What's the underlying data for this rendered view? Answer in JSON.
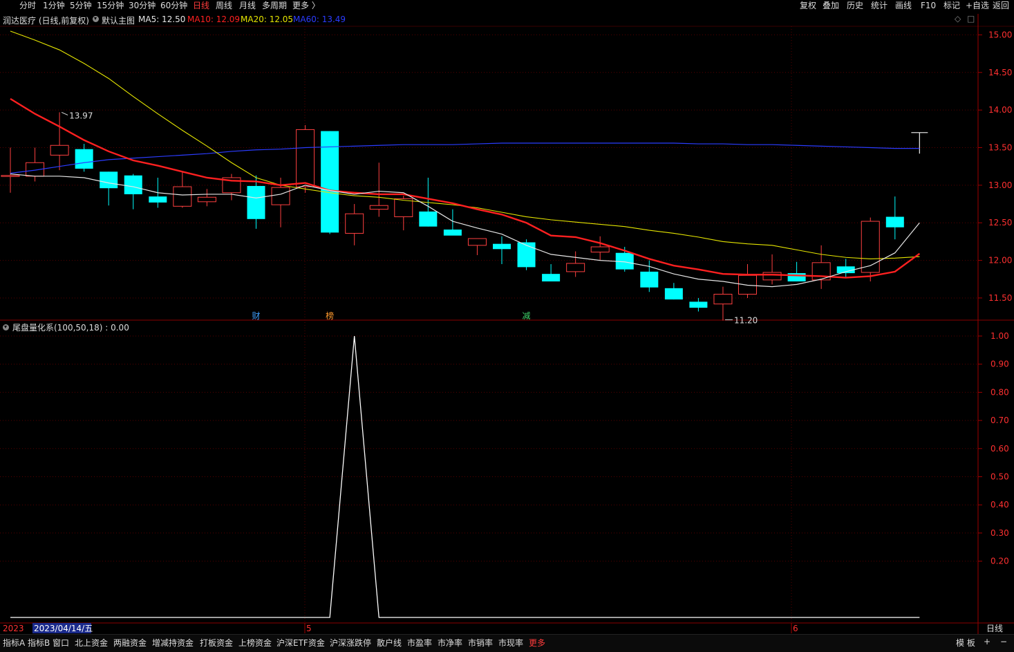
{
  "toolbar": {
    "periods": [
      "分时",
      "1分钟",
      "5分钟",
      "15分钟",
      "30分钟",
      "60分钟",
      "日线",
      "周线",
      "月线",
      "多周期",
      "更多 〉"
    ],
    "active_period": "日线",
    "right_tools": [
      "复权",
      "叠加",
      "历史",
      "统计",
      "画线",
      "F10",
      "标记",
      "+自选",
      "返回"
    ]
  },
  "main_panel": {
    "stock_title": "润达医疗 (日线,前复权)",
    "template_label": "默认主图",
    "ma": [
      {
        "label": "MA5: 12.50",
        "color": "#e6e6e6"
      },
      {
        "label": "MA10: 12.09",
        "color": "#ff2020"
      },
      {
        "label": "MA20: 12.05",
        "color": "#e6e600"
      },
      {
        "label": "MA60: 13.49",
        "color": "#2b3cff"
      }
    ],
    "high_marker": "13.97",
    "low_marker": "11.20",
    "event_tags": [
      {
        "text": "财",
        "color": "#3fa0ff"
      },
      {
        "text": "榜",
        "color": "#ff9a2e"
      },
      {
        "text": "减",
        "color": "#3fd36a"
      }
    ],
    "price_axis": [
      "15.00",
      "14.50",
      "14.00",
      "13.50",
      "13.00",
      "12.50",
      "12.00",
      "11.50"
    ],
    "ylim": [
      11.15,
      15.05
    ]
  },
  "indicator_panel": {
    "title": "尾盘量化系(100,50,18) : 0.00",
    "axis": [
      "1.00",
      "0.90",
      "0.80",
      "0.70",
      "0.60",
      "0.50",
      "0.40",
      "0.30",
      "0.20"
    ],
    "ylim": [
      0,
      1.0
    ]
  },
  "date_axis": {
    "start_label": "2023",
    "cursor_date": "2023/04/14/五",
    "month_labels": [
      "5",
      "6"
    ],
    "period_label": "日线"
  },
  "chart_data": {
    "type": "candlestick",
    "candles": [
      {
        "o": 13.13,
        "h": 13.5,
        "l": 12.9,
        "c": 13.13
      },
      {
        "o": 13.12,
        "h": 13.5,
        "l": 13.05,
        "c": 13.3
      },
      {
        "o": 13.4,
        "h": 13.97,
        "l": 13.2,
        "c": 13.53
      },
      {
        "o": 13.48,
        "h": 13.55,
        "l": 13.18,
        "c": 13.22
      },
      {
        "o": 13.18,
        "h": 13.18,
        "l": 12.73,
        "c": 12.96
      },
      {
        "o": 13.13,
        "h": 13.15,
        "l": 12.68,
        "c": 12.88
      },
      {
        "o": 12.85,
        "h": 13.1,
        "l": 12.7,
        "c": 12.77
      },
      {
        "o": 12.72,
        "h": 13.18,
        "l": 12.7,
        "c": 12.98
      },
      {
        "o": 12.78,
        "h": 12.95,
        "l": 12.72,
        "c": 12.84
      },
      {
        "o": 12.9,
        "h": 13.15,
        "l": 12.8,
        "c": 13.1
      },
      {
        "o": 12.99,
        "h": 13.13,
        "l": 12.42,
        "c": 12.55
      },
      {
        "o": 12.74,
        "h": 13.1,
        "l": 12.44,
        "c": 12.97
      },
      {
        "o": 12.98,
        "h": 13.8,
        "l": 12.9,
        "c": 13.74
      },
      {
        "o": 13.72,
        "h": 13.72,
        "l": 12.35,
        "c": 12.37
      },
      {
        "o": 12.36,
        "h": 12.75,
        "l": 12.2,
        "c": 12.62
      },
      {
        "o": 12.68,
        "h": 13.3,
        "l": 12.58,
        "c": 12.73
      },
      {
        "o": 12.58,
        "h": 12.86,
        "l": 12.4,
        "c": 12.82
      },
      {
        "o": 12.65,
        "h": 13.1,
        "l": 12.45,
        "c": 12.45
      },
      {
        "o": 12.41,
        "h": 12.68,
        "l": 12.35,
        "c": 12.33
      },
      {
        "o": 12.2,
        "h": 12.22,
        "l": 12.07,
        "c": 12.29
      },
      {
        "o": 12.22,
        "h": 12.32,
        "l": 11.95,
        "c": 12.15
      },
      {
        "o": 12.24,
        "h": 12.28,
        "l": 11.87,
        "c": 11.91
      },
      {
        "o": 11.82,
        "h": 11.95,
        "l": 11.75,
        "c": 11.72
      },
      {
        "o": 11.85,
        "h": 12.12,
        "l": 11.78,
        "c": 11.96
      },
      {
        "o": 12.11,
        "h": 12.32,
        "l": 12.0,
        "c": 12.18
      },
      {
        "o": 12.1,
        "h": 12.18,
        "l": 11.85,
        "c": 11.88
      },
      {
        "o": 11.85,
        "h": 12.0,
        "l": 11.58,
        "c": 11.64
      },
      {
        "o": 11.63,
        "h": 11.7,
        "l": 11.48,
        "c": 11.48
      },
      {
        "o": 11.45,
        "h": 11.5,
        "l": 11.32,
        "c": 11.37
      },
      {
        "o": 11.42,
        "h": 11.65,
        "l": 11.2,
        "c": 11.55
      },
      {
        "o": 11.55,
        "h": 11.95,
        "l": 11.5,
        "c": 11.8
      },
      {
        "o": 11.74,
        "h": 12.08,
        "l": 11.68,
        "c": 11.84
      },
      {
        "o": 11.83,
        "h": 11.98,
        "l": 11.72,
        "c": 11.72
      },
      {
        "o": 11.74,
        "h": 12.2,
        "l": 11.62,
        "c": 11.97
      },
      {
        "o": 11.92,
        "h": 12.02,
        "l": 11.77,
        "c": 11.83
      },
      {
        "o": 11.84,
        "h": 12.57,
        "l": 11.72,
        "c": 12.52
      },
      {
        "o": 12.58,
        "h": 12.85,
        "l": 12.28,
        "c": 12.44
      },
      {
        "o": 13.7,
        "h": 13.7,
        "l": 13.42,
        "c": 13.7
      }
    ],
    "ma5": [
      13.15,
      13.12,
      13.12,
      13.1,
      13.03,
      12.98,
      12.9,
      12.87,
      12.88,
      12.88,
      12.83,
      12.88,
      13.0,
      12.93,
      12.88,
      12.92,
      12.9,
      12.72,
      12.52,
      12.43,
      12.35,
      12.2,
      12.08,
      12.04,
      12.0,
      11.98,
      11.92,
      11.82,
      11.75,
      11.72,
      11.67,
      11.65,
      11.68,
      11.75,
      11.85,
      11.93,
      12.1,
      12.5
    ],
    "ma10": [
      14.15,
      13.95,
      13.78,
      13.6,
      13.45,
      13.33,
      13.26,
      13.18,
      13.1,
      13.06,
      13.05,
      13.0,
      13.03,
      12.93,
      12.9,
      12.88,
      12.88,
      12.82,
      12.76,
      12.68,
      12.61,
      12.5,
      12.33,
      12.31,
      12.23,
      12.13,
      12.02,
      11.93,
      11.88,
      11.82,
      11.81,
      11.81,
      11.8,
      11.79,
      11.77,
      11.79,
      11.85,
      12.09
    ],
    "ma20": [
      15.05,
      14.93,
      14.8,
      14.62,
      14.42,
      14.18,
      13.95,
      13.73,
      13.52,
      13.3,
      13.1,
      13.0,
      12.95,
      12.9,
      12.86,
      12.84,
      12.8,
      12.77,
      12.74,
      12.7,
      12.64,
      12.58,
      12.54,
      12.51,
      12.48,
      12.45,
      12.4,
      12.36,
      12.31,
      12.25,
      12.22,
      12.2,
      12.14,
      12.08,
      12.04,
      12.02,
      12.03,
      12.05
    ],
    "ma60": [
      13.16,
      13.2,
      13.25,
      13.3,
      13.34,
      13.36,
      13.38,
      13.4,
      13.42,
      13.45,
      13.47,
      13.48,
      13.5,
      13.51,
      13.52,
      13.53,
      13.54,
      13.54,
      13.54,
      13.55,
      13.56,
      13.56,
      13.56,
      13.56,
      13.56,
      13.56,
      13.56,
      13.56,
      13.55,
      13.55,
      13.54,
      13.54,
      13.53,
      13.52,
      13.51,
      13.5,
      13.49,
      13.49
    ],
    "indicator": [
      0,
      0,
      0,
      0,
      0,
      0,
      0,
      0,
      0,
      0,
      0,
      0,
      0,
      0,
      1.0,
      0,
      0,
      0,
      0,
      0,
      0,
      0,
      0,
      0,
      0,
      0,
      0,
      0,
      0,
      0,
      0,
      0,
      0,
      0,
      0,
      0,
      0,
      0
    ],
    "up_color": "#ff4040",
    "down_color": "#00ffff"
  }
}
